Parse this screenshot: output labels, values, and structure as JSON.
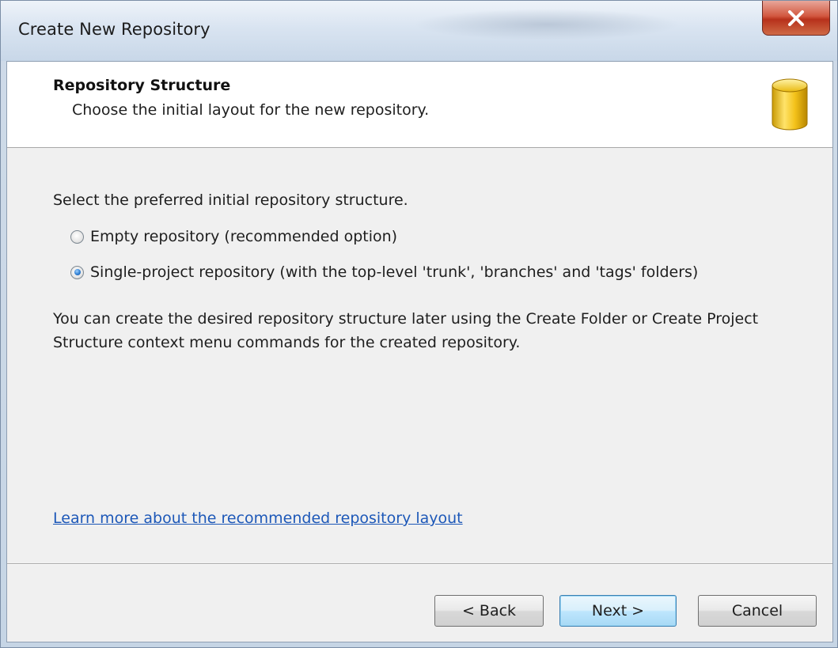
{
  "window": {
    "title": "Create New Repository",
    "close_label": "close"
  },
  "header": {
    "title": "Repository Structure",
    "subtitle": "Choose the initial layout for the new repository.",
    "icon": "database-cylinder-icon"
  },
  "main": {
    "prompt": "Select the preferred initial repository structure.",
    "options": [
      {
        "label": "Empty repository (recommended option)",
        "checked": false
      },
      {
        "label": "Single-project repository (with the top-level 'trunk', 'branches' and 'tags' folders)",
        "checked": true
      }
    ],
    "info": "You can create the desired repository structure later using the Create Folder or Create Project Structure context menu commands for the created repository.",
    "link": "Learn more about the recommended repository layout"
  },
  "footer": {
    "back_label": "< Back",
    "next_label": "Next >",
    "cancel_label": "Cancel"
  },
  "colors": {
    "link": "#1d58b8",
    "close_button": "#c8432a",
    "icon_gold": "#f2c41a"
  }
}
